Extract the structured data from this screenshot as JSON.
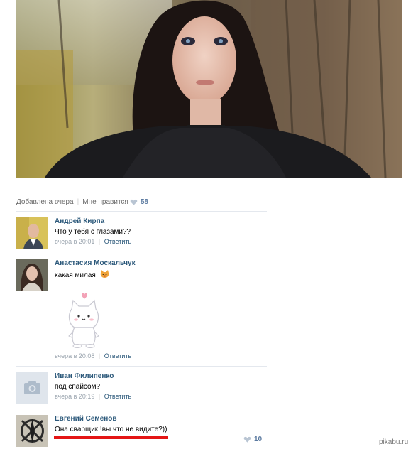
{
  "post": {
    "added_label": "Добавлена вчера",
    "like_label": "Мне нравится",
    "like_count": "58"
  },
  "comments": [
    {
      "author": "Андрей Кирпа",
      "text": "Что у тебя с глазами??",
      "time": "вчера в 20:01",
      "reply_label": "Ответить"
    },
    {
      "author": "Анастасия Москальчук",
      "text": "какая милая",
      "time": "вчера в 20:08",
      "reply_label": "Ответить"
    },
    {
      "author": "Иван Филипенко",
      "text": "под спайсом?",
      "time": "вчера в 20:19",
      "reply_label": "Ответить"
    },
    {
      "author": "Евгений Семёнов",
      "text": "Она сварщик!!вы что не видите?))",
      "like_count": "10"
    }
  ],
  "watermark": "pikabu.ru",
  "colors": {
    "link": "#2b587a",
    "meta": "#6a6a6a",
    "divider": "#e4e8ee",
    "highlight": "#e41515"
  }
}
